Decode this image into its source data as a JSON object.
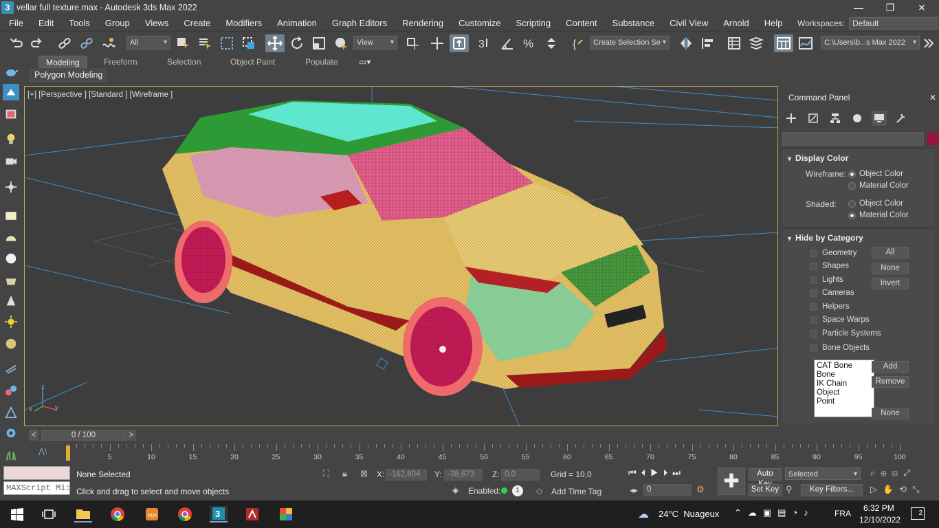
{
  "window": {
    "app_icon": "3",
    "title": "vellar full texture.max - Autodesk 3ds Max 2022",
    "minimize_glyph": "—",
    "restore_glyph": "❐",
    "close_glyph": "✕"
  },
  "menu": [
    "File",
    "Edit",
    "Tools",
    "Group",
    "Views",
    "Create",
    "Modifiers",
    "Animation",
    "Graph Editors",
    "Rendering",
    "Customize",
    "Scripting",
    "Content",
    "Substance",
    "Civil View",
    "Arnold",
    "Help"
  ],
  "workspace": {
    "label": "Workspaces:",
    "value": "Default"
  },
  "toolbar": {
    "filter_value": "All",
    "refcoord_value": "View",
    "selection_set_value": "Create Selection Se",
    "project_path": "C:\\Users\\b...s Max 2022",
    "icons": [
      "undo-icon",
      "redo-icon",
      "link-icon",
      "unlink-icon",
      "bind-spacewarp-icon",
      "select-object-icon",
      "select-by-name-icon",
      "rect-selection-icon",
      "window-crossing-icon",
      "select-move-icon",
      "select-rotate-icon",
      "select-scale-icon",
      "placement-icon",
      "pivot-icon",
      "manipulate-icon",
      "keyboard-shortcut-icon",
      "snap-3d-icon",
      "angle-snap-icon",
      "percent-snap-icon",
      "spinner-snap-icon",
      "edit-named-sets-icon",
      "mirror-icon",
      "align-icon",
      "scene-explorer-icon",
      "layer-explorer-icon",
      "ribbon-toggle-icon",
      "curve-editor-icon"
    ]
  },
  "ribbon": {
    "tabs": [
      "Modeling",
      "Freeform",
      "Selection",
      "Object Paint",
      "Populate"
    ],
    "active_tab": "Modeling",
    "sub_panel": "Polygon Modeling"
  },
  "viewport": {
    "label": "[+] [Perspective ] [Standard ] [Wireframe ]",
    "axis_z": "z",
    "axis_x": "x",
    "axis_y": "y"
  },
  "command_panel": {
    "title": "Command Panel",
    "close_glyph": "✕",
    "tabs": [
      "create-icon",
      "modify-icon",
      "hierarchy-icon",
      "motion-icon",
      "display-icon",
      "utilities-icon"
    ],
    "active_tab": "display-icon",
    "object_color": "#9a1240",
    "display_color": {
      "header": "Display Color",
      "wireframe_label": "Wireframe:",
      "shaded_label": "Shaded:",
      "wireframe_options": [
        "Object Color",
        "Material Color"
      ],
      "wireframe_selected": "Object Color",
      "shaded_options": [
        "Object Color",
        "Material Color"
      ],
      "shaded_selected": "Material Color"
    },
    "hide_by_category": {
      "header": "Hide by Category",
      "categories": [
        "Geometry",
        "Shapes",
        "Lights",
        "Cameras",
        "Helpers",
        "Space Warps",
        "Particle Systems",
        "Bone Objects"
      ],
      "buttons": [
        "All",
        "None",
        "Invert"
      ],
      "list": [
        "CAT Bone",
        "Bone",
        "IK Chain Object",
        "Point"
      ],
      "list_buttons": [
        "Add",
        "Remove",
        "None"
      ]
    }
  },
  "timeline": {
    "frame_display": "0 / 100",
    "prev": "<",
    "next": ">",
    "ticks": [
      "0",
      "5",
      "10",
      "15",
      "20",
      "25",
      "30",
      "35",
      "40",
      "45",
      "50",
      "55",
      "60",
      "65",
      "70",
      "75",
      "80",
      "85",
      "90",
      "95",
      "100"
    ]
  },
  "status": {
    "maxscript_placeholder": "MAXScript Mi:",
    "selection": "None Selected",
    "prompt": "Click and drag to select and move objects",
    "x_label": "X:",
    "x_value": "-162,804",
    "y_label": "Y:",
    "y_value": "-38,673",
    "z_label": "Z:",
    "z_value": "0,0",
    "grid": "Grid = 10,0",
    "enabled_label": "Enabled:",
    "enabled_count": "1",
    "add_time_tag": "Add Time Tag",
    "frame_value": "0",
    "auto_key": "Auto Key",
    "set_key": "Set Key",
    "key_mode": "Selected",
    "key_filters": "Key Filters..."
  },
  "taskbar": {
    "weather": "24°C  Nuageux",
    "language": "FRA",
    "time": "6:32 PM",
    "date": "12/10/2022",
    "notification_count": "2",
    "apps": [
      "start-icon",
      "task-view-icon",
      "file-explorer-icon",
      "chrome-icon",
      "pdf-icon",
      "chrome-alt-icon",
      "3dsmax-icon",
      "flash-icon",
      "color-app-icon"
    ]
  }
}
